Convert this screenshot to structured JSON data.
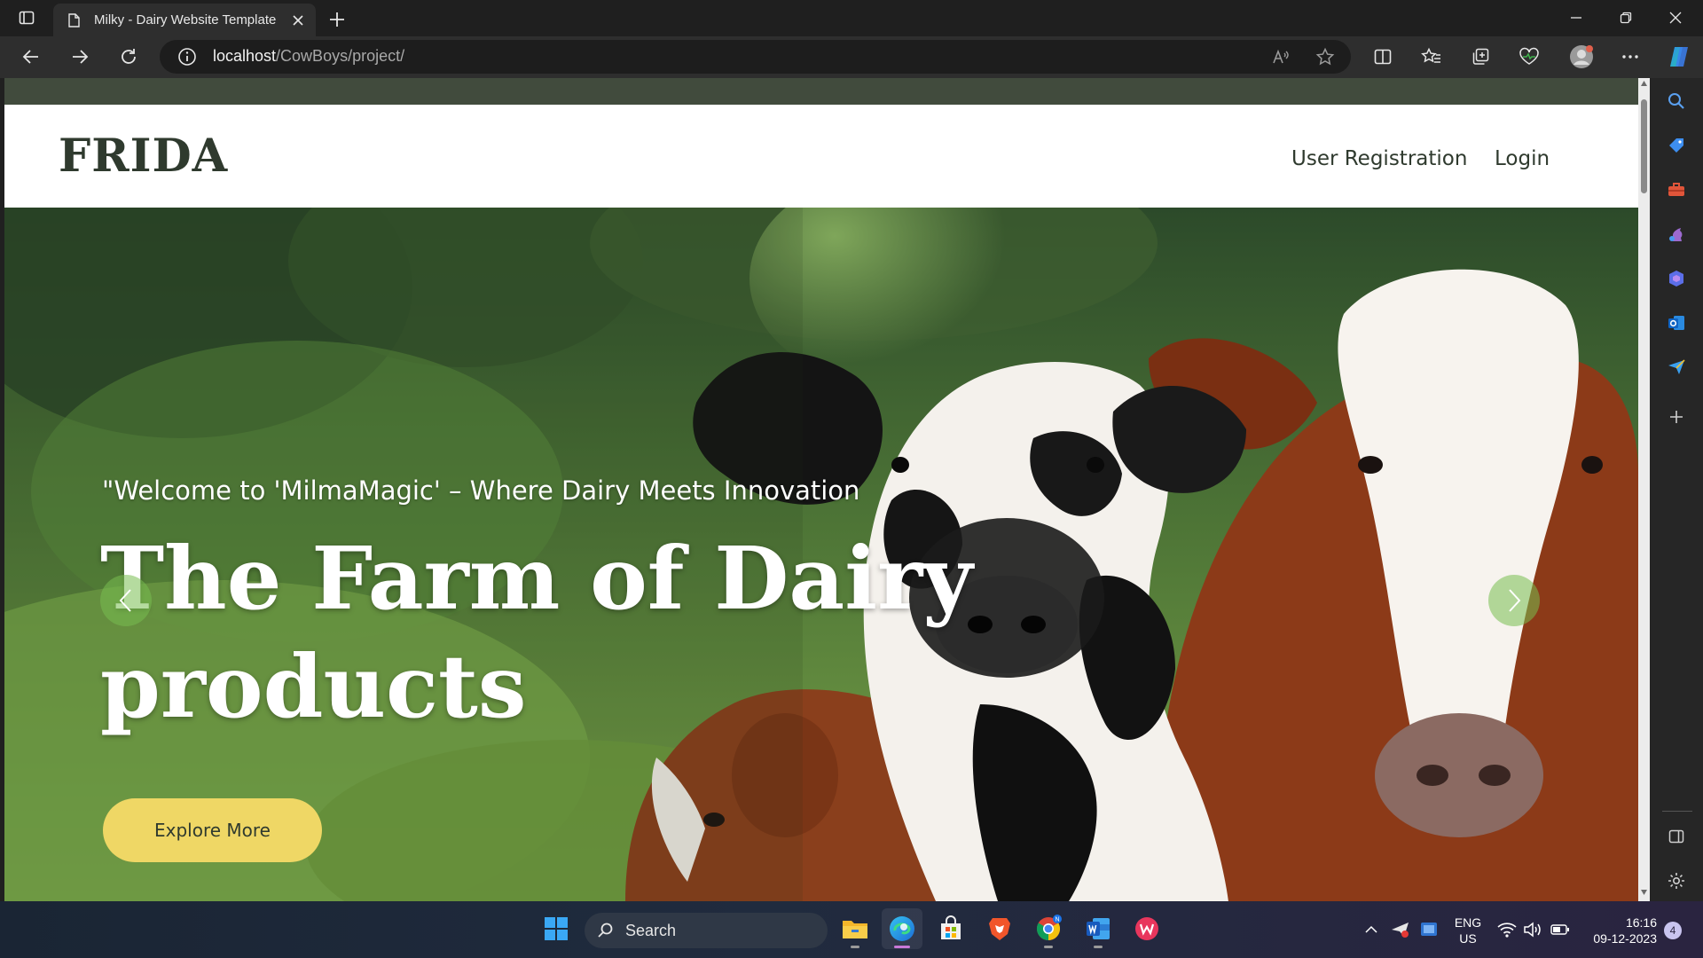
{
  "browser": {
    "tab_title": "Milky - Dairy Website Template",
    "url_host": "localhost",
    "url_path": "/CowBoys/project/"
  },
  "site": {
    "logo": "FRIDA",
    "nav": [
      "User Registration",
      "Login"
    ],
    "hero": {
      "tagline": "\"Welcome to 'MilmaMagic' – Where Dairy Meets Innovation",
      "headline": "The Farm of Dairy products",
      "cta": "Explore More"
    }
  },
  "taskbar": {
    "search_label": "Search",
    "lang_line1": "ENG",
    "lang_line2": "US",
    "time": "16:16",
    "date": "09-12-2023",
    "notification_count": "4"
  },
  "colors": {
    "accent_button": "#efd765",
    "brand_text": "#2f3a2e",
    "nav_bg": "#ffffff"
  }
}
